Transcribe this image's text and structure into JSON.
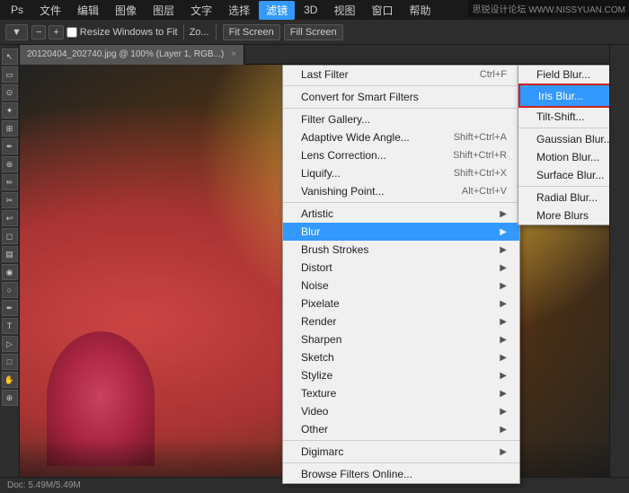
{
  "menubar": {
    "items": [
      "PS",
      "文件",
      "编辑",
      "图像",
      "图层",
      "文字",
      "选择",
      "滤镜",
      "3D",
      "视图",
      "窗口",
      "帮助"
    ],
    "active": "滤镜",
    "watermark": "思锐设计论坛  WWW.NISSYUAN.COM"
  },
  "toolbar": {
    "resize_label": "Resize Windows to Fit",
    "zoom_label": "Zo...",
    "fit_screen": "Fit Screen",
    "fill_screen": "Fill Screen"
  },
  "canvas_tab": {
    "title": "20120404_202740.jpg @ 100% (Layer 1, RGB...)",
    "close": "×"
  },
  "filter_menu": {
    "items": [
      {
        "label": "Last Filter",
        "shortcut": "Ctrl+F",
        "submenu": false
      },
      {
        "label": "",
        "separator": true
      },
      {
        "label": "Convert for Smart Filters",
        "shortcut": "",
        "submenu": false
      },
      {
        "label": "",
        "separator": true
      },
      {
        "label": "Filter Gallery...",
        "shortcut": "",
        "submenu": false
      },
      {
        "label": "Adaptive Wide Angle...",
        "shortcut": "Shift+Ctrl+A",
        "submenu": false
      },
      {
        "label": "Lens Correction...",
        "shortcut": "Shift+Ctrl+R",
        "submenu": false
      },
      {
        "label": "Liquify...",
        "shortcut": "Shift+Ctrl+X",
        "submenu": false
      },
      {
        "label": "Vanishing Point...",
        "shortcut": "Alt+Ctrl+V",
        "submenu": false
      },
      {
        "label": "",
        "separator": true
      },
      {
        "label": "Artistic",
        "shortcut": "",
        "submenu": true
      },
      {
        "label": "Blur",
        "shortcut": "",
        "submenu": true,
        "highlighted": true
      },
      {
        "label": "Brush Strokes",
        "shortcut": "",
        "submenu": true
      },
      {
        "label": "Distort",
        "shortcut": "",
        "submenu": true
      },
      {
        "label": "Noise",
        "shortcut": "",
        "submenu": true
      },
      {
        "label": "Pixelate",
        "shortcut": "",
        "submenu": true
      },
      {
        "label": "Render",
        "shortcut": "",
        "submenu": true
      },
      {
        "label": "Sharpen",
        "shortcut": "",
        "submenu": true
      },
      {
        "label": "Sketch",
        "shortcut": "",
        "submenu": true
      },
      {
        "label": "Stylize",
        "shortcut": "",
        "submenu": true
      },
      {
        "label": "Texture",
        "shortcut": "",
        "submenu": true
      },
      {
        "label": "Video",
        "shortcut": "",
        "submenu": true
      },
      {
        "label": "Other",
        "shortcut": "",
        "submenu": true
      },
      {
        "label": "",
        "separator": true
      },
      {
        "label": "Digimarc",
        "shortcut": "",
        "submenu": true
      },
      {
        "label": "",
        "separator": true
      },
      {
        "label": "Browse Filters Online...",
        "shortcut": "",
        "submenu": false
      }
    ]
  },
  "blur_submenu": {
    "items": [
      {
        "label": "Field Blur...",
        "shortcut": "",
        "submenu": false
      },
      {
        "label": "Iris Blur...",
        "shortcut": "",
        "submenu": false,
        "highlighted": true
      },
      {
        "label": "Tilt-Shift...",
        "shortcut": "",
        "submenu": false
      },
      {
        "label": "",
        "separator": true
      },
      {
        "label": "Gaussian Blur...",
        "shortcut": "",
        "submenu": false
      },
      {
        "label": "Motion Blur...",
        "shortcut": "",
        "submenu": false
      },
      {
        "label": "Surface Blur...",
        "shortcut": "",
        "submenu": false
      },
      {
        "label": "",
        "separator": true
      },
      {
        "label": "Radial Blur...",
        "shortcut": "",
        "submenu": false
      },
      {
        "label": "More Blurs",
        "shortcut": "",
        "submenu": true
      }
    ]
  },
  "sidebar_tools": [
    "M",
    "L",
    "C",
    "S",
    "P",
    "T",
    "G",
    "E",
    "B",
    "H",
    "Z"
  ],
  "status": {
    "text": "Doc: 5.49M/5.49M"
  }
}
